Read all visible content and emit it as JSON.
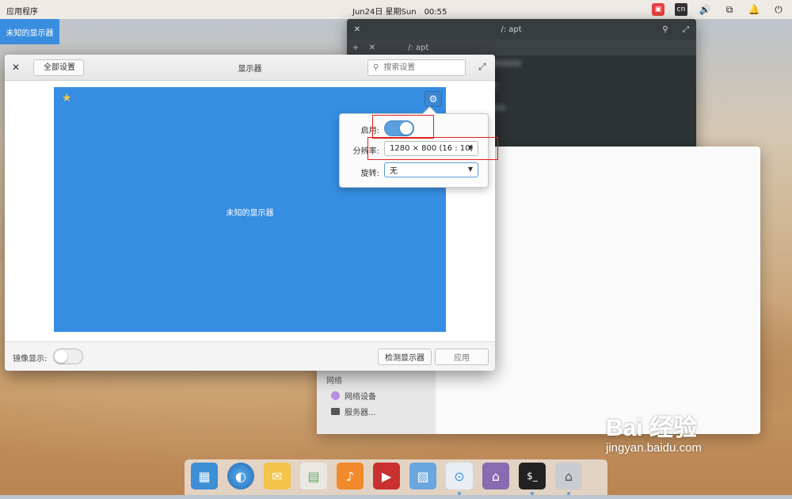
{
  "top_panel": {
    "apps_label": "应用程序",
    "date": "Jun24日 星期Sun",
    "time": "00:55",
    "lang_indicator": "cn",
    "indicators": [
      "notification-app-icon",
      "keyboard-layout-icon",
      "volume-icon",
      "network-icon",
      "notifications-icon",
      "power-icon"
    ]
  },
  "monitor_tag": "未知的显示器",
  "terminal": {
    "title": "/: apt",
    "tab_label": "/: apt"
  },
  "network_window": {
    "section_heading": "网络",
    "items": [
      "网络设备",
      "服务器..."
    ]
  },
  "display_window": {
    "back_label": "全部设置",
    "title": "显示器",
    "search_placeholder": "搜索设置",
    "monitor_name": "未知的显示器",
    "mirror_label": "镜像显示:",
    "mirror_enabled": false,
    "detect_button": "检测显示器",
    "apply_button": "应用"
  },
  "popover": {
    "enable_label": "启用:",
    "enabled": true,
    "resolution_label": "分辨率:",
    "resolution_value": "1280 × 800 (16 : 10)",
    "rotation_label": "旋转:",
    "rotation_value": "无"
  },
  "dock": {
    "apps": [
      "multitasking-view-icon",
      "web-browser-icon",
      "mail-icon",
      "calendar-icon",
      "music-icon",
      "videos-icon",
      "photos-icon",
      "system-settings-icon",
      "appcenter-icon",
      "terminal-icon",
      "files-icon"
    ]
  },
  "watermark": {
    "main": "Bai 经验",
    "url": "jingyan.baidu.com"
  },
  "colors": {
    "accent": "#368ee2",
    "highlight": "#e02020"
  }
}
